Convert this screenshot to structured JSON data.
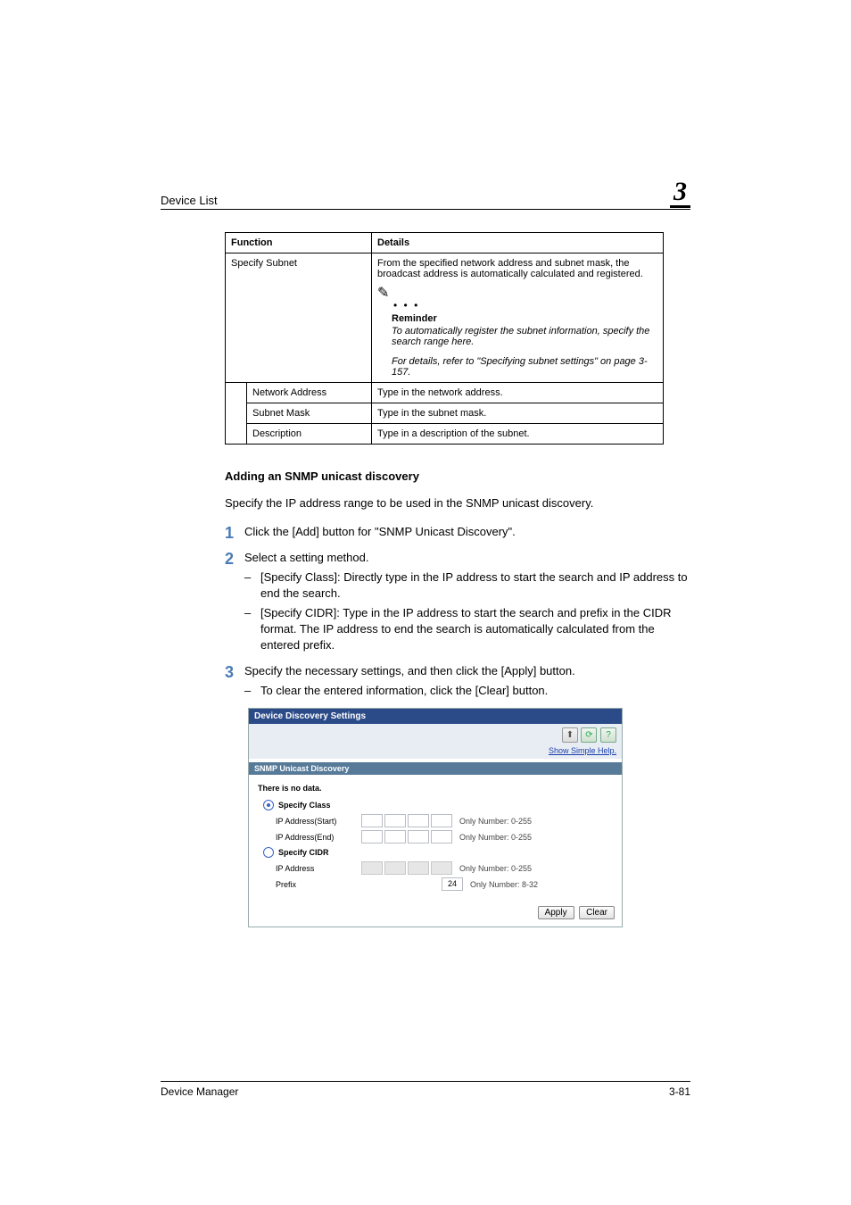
{
  "header": {
    "section": "Device List",
    "chapter": "3"
  },
  "table": {
    "head": {
      "function": "Function",
      "details": "Details"
    },
    "row_specify_subnet": {
      "label": "Specify Subnet",
      "desc": "From the specified network address and subnet mask, the broadcast address is automatically calculated and registered.",
      "reminder_title": "Reminder",
      "reminder_body": "To automatically register the subnet information, specify the search range here.",
      "reminder_ref": "For details, refer to \"Specifying subnet settings\" on page 3-157."
    },
    "row_network_address": {
      "label": "Network Address",
      "desc": "Type in the network address."
    },
    "row_subnet_mask": {
      "label": "Subnet Mask",
      "desc": "Type in the subnet mask."
    },
    "row_description": {
      "label": "Description",
      "desc": "Type in a description of the subnet."
    }
  },
  "section_heading": "Adding an SNMP unicast discovery",
  "intro": "Specify the IP address range to be used in the SNMP unicast discovery.",
  "steps": {
    "s1": {
      "num": "1",
      "text": "Click the [Add] button for \"SNMP Unicast Discovery\"."
    },
    "s2": {
      "num": "2",
      "text": "Select a setting method.",
      "sub1": "[Specify Class]: Directly type in the IP address to start the search and IP address to end the search.",
      "sub2": "[Specify CIDR]: Type in the IP address to start the search and prefix in the CIDR format. The IP address to end the search is automatically calculated from the entered prefix."
    },
    "s3": {
      "num": "3",
      "text": "Specify the necessary settings, and then click the [Apply] button.",
      "sub1": "To clear the entered information, click the [Clear] button."
    }
  },
  "shot": {
    "title": "Device Discovery Settings",
    "help_link": "Show Simple Help.",
    "tab": "SNMP Unicast Discovery",
    "no_data": "There is no data.",
    "specify_class": "Specify Class",
    "ip_start": "IP Address(Start)",
    "ip_end": "IP Address(End)",
    "specify_cidr": "Specify CIDR",
    "ip_address": "IP Address",
    "prefix": "Prefix",
    "prefix_value": "24",
    "hint_0_255": "Only Number: 0-255",
    "hint_8_32": "Only Number: 8-32",
    "apply": "Apply",
    "clear": "Clear"
  },
  "footer": {
    "left": "Device Manager",
    "right": "3-81"
  }
}
